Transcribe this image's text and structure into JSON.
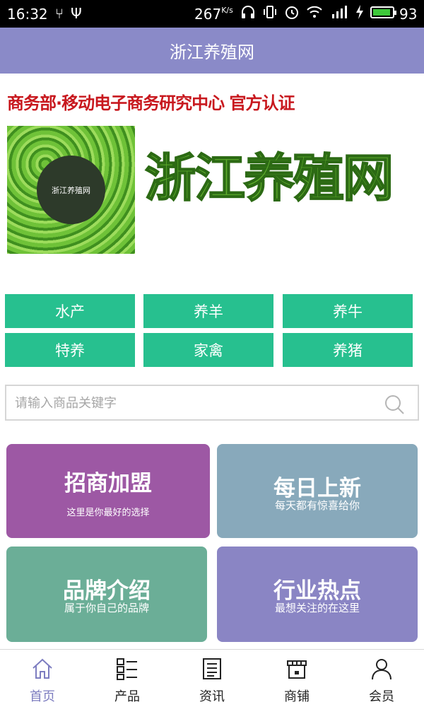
{
  "status_bar": {
    "time": "16:32",
    "net_speed": "267",
    "net_unit": "K/s",
    "battery_level": "93",
    "battery_fraction": 0.93,
    "left_icons": [
      "share-icon",
      "usb-icon"
    ],
    "right_icons": [
      "headphones-icon",
      "vibrate-icon",
      "alarm-icon",
      "wifi-icon",
      "signal-4g-icon",
      "charging-icon",
      "battery-icon"
    ]
  },
  "header": {
    "title": "浙江养殖网"
  },
  "banner": {
    "certification": "商务部·移动电子商务研究中心 官方认证",
    "logo_small": "浙江养殖网",
    "logo_large": "浙江养殖网"
  },
  "categories": [
    {
      "label": "水产"
    },
    {
      "label": "养羊"
    },
    {
      "label": "养牛"
    },
    {
      "label": "特养"
    },
    {
      "label": "家禽"
    },
    {
      "label": "养猪"
    }
  ],
  "search": {
    "placeholder": "请输入商品关键字",
    "value": ""
  },
  "cards": [
    {
      "title": "招商加盟",
      "subtitle": "这里是你最好的选择",
      "color": "#9d58a4"
    },
    {
      "title": "每日上新",
      "subtitle": "每天都有惊喜给你",
      "color": "#88a9bb"
    },
    {
      "title": "品牌介绍",
      "subtitle": "属于你自己的品牌",
      "color": "#6bae97"
    },
    {
      "title": "行业热点",
      "subtitle": "最想关注的在这里",
      "color": "#8a85c4"
    }
  ],
  "tabbar": [
    {
      "label": "首页",
      "icon": "home-icon",
      "active": true
    },
    {
      "label": "产品",
      "icon": "grid-list-icon"
    },
    {
      "label": "资讯",
      "icon": "news-icon"
    },
    {
      "label": "商铺",
      "icon": "shop-icon"
    },
    {
      "label": "会员",
      "icon": "user-icon"
    }
  ],
  "colors": {
    "header_bg": "#8a8ac8",
    "category_bg": "#27c08f",
    "cert_text": "#c8181e",
    "tab_active": "#7d7dc0"
  }
}
